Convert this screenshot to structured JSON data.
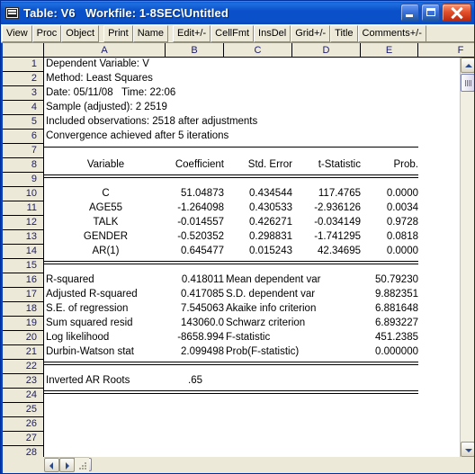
{
  "window": {
    "title": "Table: V6   Workfile: 1-8SEC\\Untitled",
    "icon": "table-icon",
    "minimize_label": "Minimize",
    "maximize_label": "Maximize",
    "close_label": "Close",
    "accent_color": "#0A50C8",
    "close_color": "#E4512B",
    "surface_color": "#ECE9D8"
  },
  "toolbar": {
    "group1": [
      "View",
      "Proc",
      "Object"
    ],
    "group2": [
      "Print",
      "Name"
    ],
    "group3": [
      "Edit+/-",
      "CellFmt",
      "InsDel",
      "Grid+/-",
      "Title",
      "Comments+/-"
    ]
  },
  "grid": {
    "columns": [
      "A",
      "B",
      "C",
      "D",
      "E",
      "F"
    ],
    "row_numbers": [
      "1",
      "2",
      "3",
      "4",
      "5",
      "6",
      "7",
      "8",
      "9",
      "10",
      "11",
      "12",
      "13",
      "14",
      "15",
      "16",
      "17",
      "18",
      "19",
      "20",
      "21",
      "22",
      "23",
      "24",
      "25",
      "26",
      "27",
      "28"
    ],
    "rows": {
      "1": {
        "a": "Dependent Variable: V"
      },
      "2": {
        "a": "Method: Least Squares"
      },
      "3": {
        "a": "Date: 05/11/08   Time: 22:06"
      },
      "4": {
        "a": "Sample (adjusted): 2 2519"
      },
      "5": {
        "a": "Included observations: 2518 after adjustments"
      },
      "6": {
        "a": "Convergence achieved after 5 iterations"
      },
      "7": {
        "rule": "single"
      },
      "8": {
        "a": "Variable",
        "b": "Coefficient",
        "c": "Std. Error",
        "d": "t-Statistic",
        "e": "Prob."
      },
      "9": {
        "rule": "double"
      },
      "10": {
        "a": "C",
        "b": "51.04873",
        "c": "0.434544",
        "d": "117.4765",
        "e": "0.0000"
      },
      "11": {
        "a": "AGE55",
        "b": "-1.264098",
        "c": "0.430533",
        "d": "-2.936126",
        "e": "0.0034"
      },
      "12": {
        "a": "TALK",
        "b": "-0.014557",
        "c": "0.426271",
        "d": "-0.034149",
        "e": "0.9728"
      },
      "13": {
        "a": "GENDER",
        "b": "-0.520352",
        "c": "0.298831",
        "d": "-1.741295",
        "e": "0.0818"
      },
      "14": {
        "a": "AR(1)",
        "b": "0.645477",
        "c": "0.015243",
        "d": "42.34695",
        "e": "0.0000"
      },
      "15": {
        "rule": "double"
      },
      "16": {
        "a": "R-squared",
        "b": "0.418011",
        "c": "Mean dependent var",
        "e": "50.79230"
      },
      "17": {
        "a": "Adjusted R-squared",
        "b": "0.417085",
        "c": "S.D. dependent var",
        "e": "9.882351"
      },
      "18": {
        "a": "S.E. of regression",
        "b": "7.545063",
        "c": "Akaike info criterion",
        "e": "6.881648"
      },
      "19": {
        "a": "Sum squared resid",
        "b": "143060.0",
        "c": "Schwarz criterion",
        "e": "6.893227"
      },
      "20": {
        "a": "Log likelihood",
        "b": "-8658.994",
        "c": "F-statistic",
        "e": "451.2385"
      },
      "21": {
        "a": "Durbin-Watson stat",
        "b": "2.099498",
        "c": "Prob(F-statistic)",
        "e": "0.000000"
      },
      "22": {
        "rule": "double"
      },
      "23": {
        "a": "Inverted AR Roots",
        "b": ".65"
      },
      "24": {
        "rule": "double"
      },
      "25": {},
      "26": {},
      "27": {},
      "28": {}
    }
  },
  "scrollbars": {
    "vertical_up": "scroll-up",
    "vertical_down": "scroll-down",
    "horizontal_left": "scroll-left",
    "horizontal_right": "scroll-right"
  }
}
